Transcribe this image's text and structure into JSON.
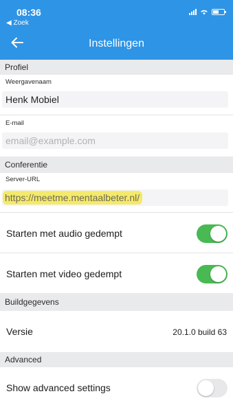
{
  "status_bar": {
    "time": "08:36",
    "back_app": "◀ Zoek"
  },
  "header": {
    "title": "Instellingen",
    "back_icon": "arrow-left-icon"
  },
  "sections": {
    "profiel": {
      "title": "Profiel",
      "display_name": {
        "label": "Weergavenaam",
        "value": "Henk Mobiel"
      },
      "email": {
        "label": "E-mail",
        "placeholder": "email@example.com"
      }
    },
    "conferentie": {
      "title": "Conferentie",
      "server_url": {
        "label": "Server-URL",
        "value": "https://meetme.mentaalbeter.nl/"
      },
      "audio_muted": {
        "label": "Starten met audio gedempt",
        "enabled": true
      },
      "video_muted": {
        "label": "Starten met video gedempt",
        "enabled": true
      }
    },
    "buildgegevens": {
      "title": "Buildgegevens",
      "version": {
        "label": "Versie",
        "value": "20.1.0 build 63"
      }
    },
    "advanced": {
      "title": "Advanced",
      "show_advanced": {
        "label": "Show advanced settings",
        "enabled": false
      }
    }
  },
  "colors": {
    "header": "#2e94e6",
    "toggle_on": "#49b953",
    "toggle_off": "#e8e8ea",
    "section_bg": "#e9eaec",
    "url_highlight": "#f5e96a"
  }
}
